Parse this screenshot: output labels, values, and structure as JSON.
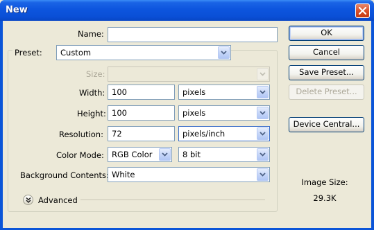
{
  "window": {
    "title": "New",
    "close_icon": "close-icon"
  },
  "form": {
    "name": {
      "label": "Name:",
      "value": ""
    },
    "preset": {
      "label": "Preset:",
      "value": "Custom"
    },
    "size": {
      "label": "Size:",
      "value": "",
      "disabled": true
    },
    "width": {
      "label": "Width:",
      "value": "100",
      "unit": "pixels"
    },
    "height": {
      "label": "Height:",
      "value": "100",
      "unit": "pixels"
    },
    "resolution": {
      "label": "Resolution:",
      "value": "72",
      "unit": "pixels/inch"
    },
    "color_mode": {
      "label": "Color Mode:",
      "value": "RGB Color",
      "depth": "8 bit"
    },
    "background": {
      "label": "Background Contents:",
      "value": "White"
    },
    "advanced": {
      "label": "Advanced"
    }
  },
  "buttons": {
    "ok": "OK",
    "cancel": "Cancel",
    "save_preset": "Save Preset...",
    "delete_preset": "Delete Preset...",
    "device_central": "Device Central..."
  },
  "info": {
    "image_size_label": "Image Size:",
    "image_size_value": "29.3K"
  },
  "colors": {
    "title_bar": "#0a4fd6",
    "dialog_bg": "#ece9d8",
    "field_border": "#7f9db9",
    "close_red": "#d9512a"
  }
}
